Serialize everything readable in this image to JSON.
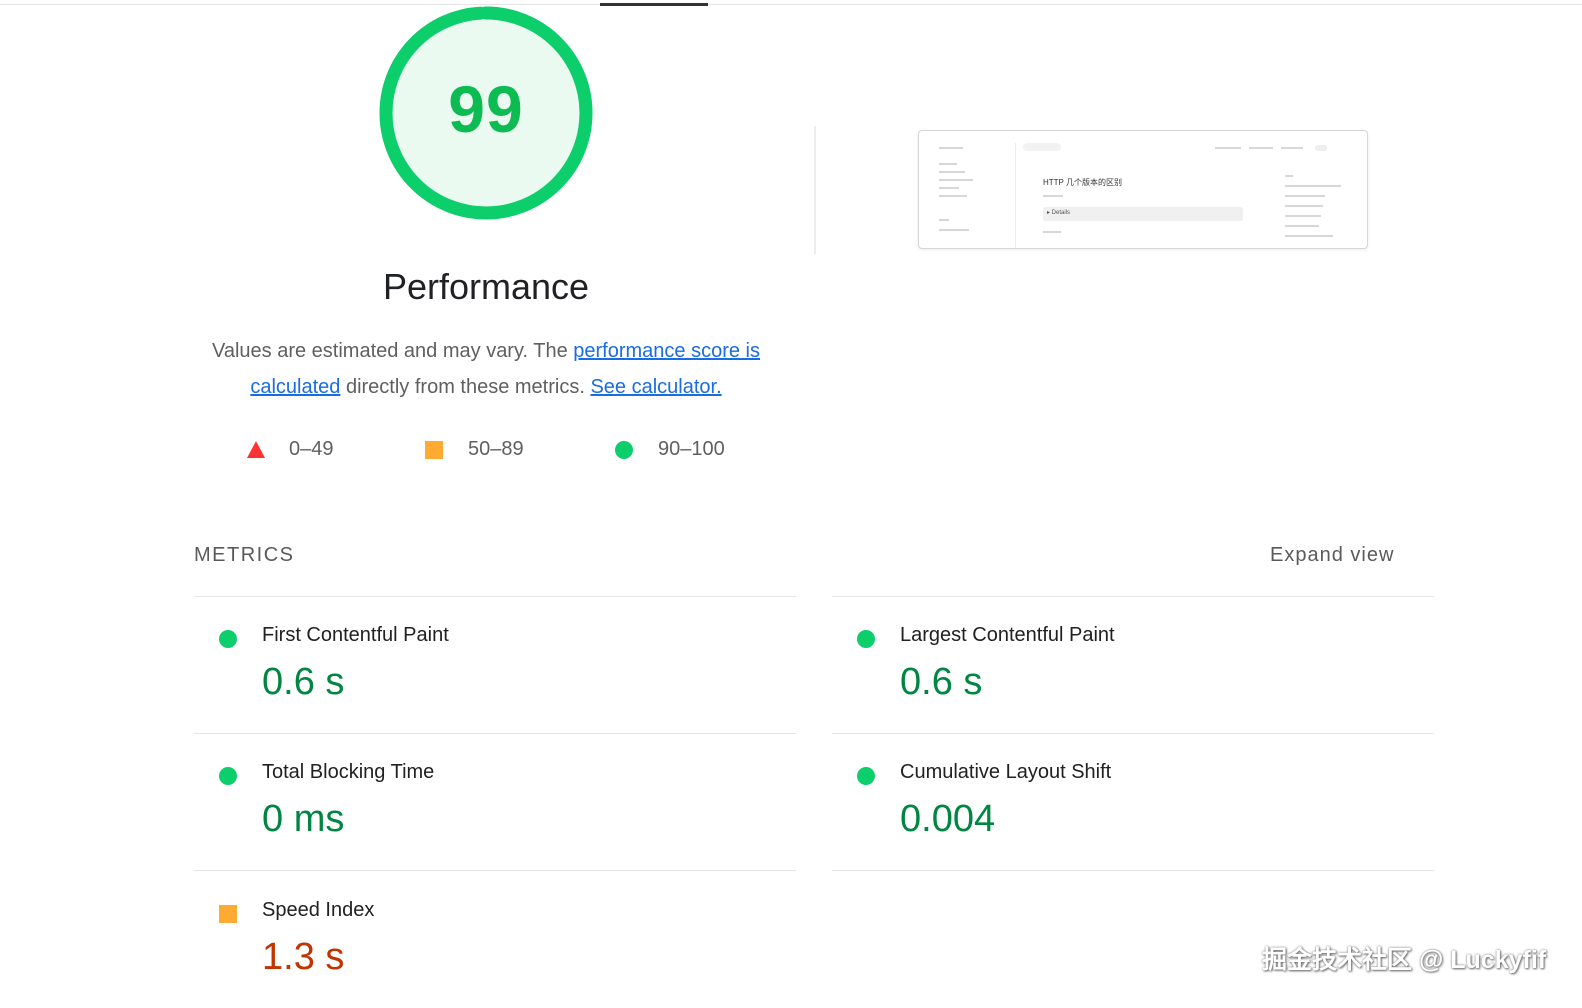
{
  "gauge": {
    "score": "99",
    "score_fraction": 0.99,
    "title": "Performance",
    "color": "#0cce6b"
  },
  "description": {
    "prefix": "Values are estimated and may vary. The ",
    "link1": "performance score is calculated",
    "middle": " directly from these metrics. ",
    "link2": "See calculator."
  },
  "legend": [
    {
      "shape": "triangle",
      "range": "0–49",
      "color": "#ff3333"
    },
    {
      "shape": "square",
      "range": "50–89",
      "color": "#ffaa33"
    },
    {
      "shape": "circle",
      "range": "90–100",
      "color": "#0cce6b"
    }
  ],
  "metrics_section": {
    "title": "METRICS",
    "expand": "Expand view"
  },
  "metrics": [
    {
      "name": "First Contentful Paint",
      "value": "0.6 s",
      "rating": "good"
    },
    {
      "name": "Largest Contentful Paint",
      "value": "0.6 s",
      "rating": "good"
    },
    {
      "name": "Total Blocking Time",
      "value": "0 ms",
      "rating": "good"
    },
    {
      "name": "Cumulative Layout Shift",
      "value": "0.004",
      "rating": "good"
    },
    {
      "name": "Speed Index",
      "value": "1.3 s",
      "rating": "average"
    }
  ],
  "thumbnail": {
    "heading": "HTTP 几个版本的区别",
    "details": "▸ Details"
  },
  "watermark": "掘金技术社区 @ Luckyfif"
}
